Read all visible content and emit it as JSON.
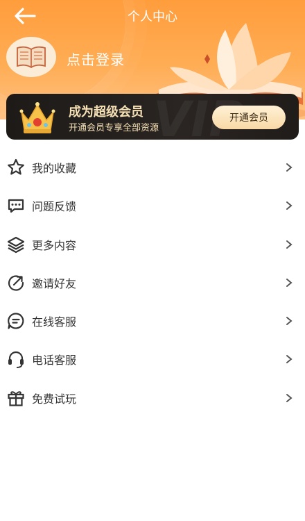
{
  "header": {
    "title": "个人中心",
    "login_label": "点击登录"
  },
  "vip": {
    "title": "成为超级会员",
    "subtitle": "开通会员专享全部资源",
    "button_label": "开通会员"
  },
  "menu": {
    "items": [
      {
        "label": "我的收藏",
        "icon": "star-icon"
      },
      {
        "label": "问题反馈",
        "icon": "chat-bubble-icon"
      },
      {
        "label": "更多内容",
        "icon": "layers-icon"
      },
      {
        "label": "邀请好友",
        "icon": "share-arrow-icon"
      },
      {
        "label": "在线客服",
        "icon": "message-icon"
      },
      {
        "label": "电话客服",
        "icon": "headset-icon"
      },
      {
        "label": "免费试玩",
        "icon": "gift-icon"
      }
    ]
  },
  "colors": {
    "header_orange": "#ff9d3c",
    "vip_dark": "#1d1a18",
    "vip_gold": "#f6e1b6"
  }
}
